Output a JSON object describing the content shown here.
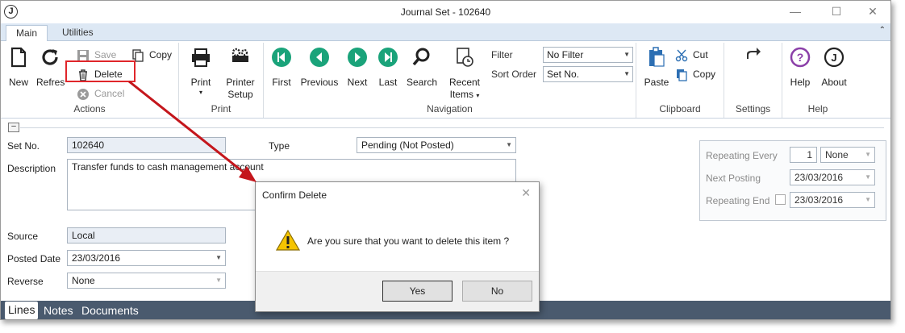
{
  "window": {
    "title": "Journal Set - 102640",
    "logo_letter": "J",
    "controls": {
      "minimize": "—",
      "maximize": "☐",
      "close": "✕"
    }
  },
  "ribbon_tabs": [
    {
      "label": "Main",
      "active": true
    },
    {
      "label": "Utilities",
      "active": false
    }
  ],
  "ribbon": {
    "actions": {
      "label": "Actions",
      "new": "New",
      "refresh": "Refresh",
      "save": "Save",
      "delete": "Delete",
      "cancel": "Cancel",
      "copy": "Copy"
    },
    "print": {
      "label": "Print",
      "print": "Print",
      "printer_setup_line1": "Printer",
      "printer_setup_line2": "Setup"
    },
    "navigation": {
      "label": "Navigation",
      "first": "First",
      "previous": "Previous",
      "next": "Next",
      "last": "Last",
      "search": "Search",
      "recent_line1": "Recent",
      "recent_line2": "Items",
      "filter_label": "Filter",
      "filter_value": "No Filter",
      "sort_label": "Sort Order",
      "sort_value": "Set No."
    },
    "clipboard": {
      "label": "Clipboard",
      "paste": "Paste",
      "cut": "Cut",
      "copy": "Copy"
    },
    "settings": {
      "label": "Settings"
    },
    "help": {
      "label": "Help",
      "help": "Help",
      "about": "About"
    }
  },
  "form": {
    "set_no_label": "Set No.",
    "set_no": "102640",
    "type_label": "Type",
    "type_value": "Pending (Not Posted)",
    "description_label": "Description",
    "description": "Transfer funds to cash management account",
    "source_label": "Source",
    "source": "Local",
    "posted_date_label": "Posted Date",
    "posted_date": "23/03/2016",
    "reverse_label": "Reverse",
    "reverse": "None",
    "repeating_every_label": "Repeating Every",
    "repeating_every_count": "1",
    "repeating_every_unit": "None",
    "next_posting_label": "Next Posting",
    "next_posting": "23/03/2016",
    "repeating_end_label": "Repeating End",
    "repeating_end": "23/03/2016"
  },
  "bottom_tabs": [
    {
      "label": "Lines",
      "active": true
    },
    {
      "label": "Notes",
      "active": false
    },
    {
      "label": "Documents",
      "active": false
    }
  ],
  "dialog": {
    "title": "Confirm Delete",
    "message": "Are you sure that you want to delete this item ?",
    "yes": "Yes",
    "no": "No"
  },
  "colors": {
    "accent_green": "#1aa37a",
    "help_purple": "#8b3fa8",
    "highlight_red": "#e0262b",
    "bottom_bar": "#4a5a6e"
  }
}
